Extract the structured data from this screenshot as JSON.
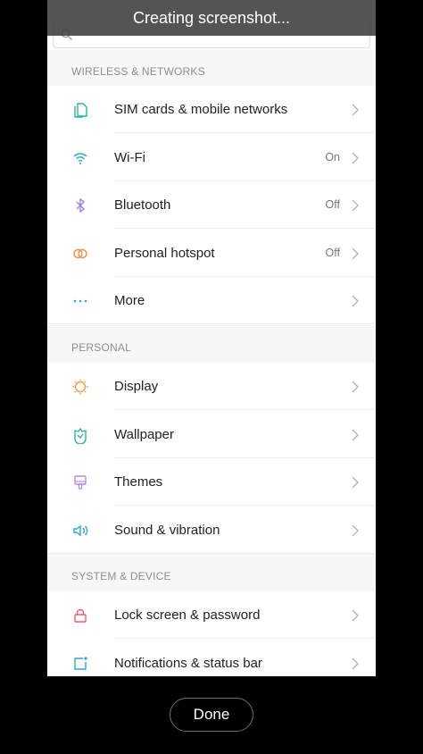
{
  "toast": {
    "text": "Creating screenshot..."
  },
  "search": {
    "placeholder": ""
  },
  "sections": [
    {
      "title": "WIRELESS & NETWORKS",
      "items": [
        {
          "label": "SIM cards & mobile networks",
          "status": "",
          "icon": "sim-card-icon",
          "color": "#2bb3a0"
        },
        {
          "label": "Wi-Fi",
          "status": "On",
          "icon": "wifi-icon",
          "color": "#2aa7d6"
        },
        {
          "label": "Bluetooth",
          "status": "Off",
          "icon": "bluetooth-icon",
          "color": "#9b7de0"
        },
        {
          "label": "Personal hotspot",
          "status": "Off",
          "icon": "hotspot-icon",
          "color": "#f08a4b"
        },
        {
          "label": "More",
          "status": "",
          "icon": "more-dots-icon",
          "color": "#2aa7d6"
        }
      ]
    },
    {
      "title": "PERSONAL",
      "items": [
        {
          "label": "Display",
          "status": "",
          "icon": "display-icon",
          "color": "#f39a3a"
        },
        {
          "label": "Wallpaper",
          "status": "",
          "icon": "wallpaper-icon",
          "color": "#2bb3a0"
        },
        {
          "label": "Themes",
          "status": "",
          "icon": "themes-icon",
          "color": "#b68ae6"
        },
        {
          "label": "Sound & vibration",
          "status": "",
          "icon": "sound-icon",
          "color": "#2aa7d6"
        }
      ]
    },
    {
      "title": "SYSTEM & DEVICE",
      "items": [
        {
          "label": "Lock screen & password",
          "status": "",
          "icon": "lock-icon",
          "color": "#ef5b6e"
        },
        {
          "label": "Notifications & status bar",
          "status": "",
          "icon": "notifications-icon",
          "color": "#2aa7d6"
        }
      ]
    }
  ],
  "done_label": "Done"
}
